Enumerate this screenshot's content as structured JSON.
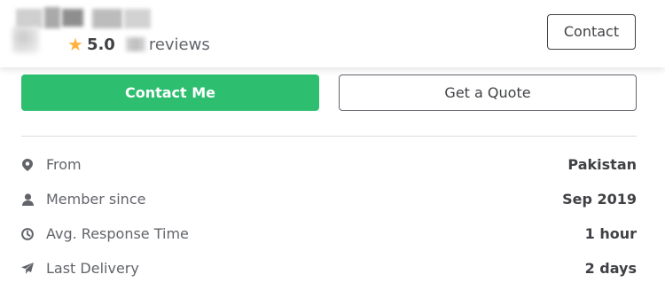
{
  "header": {
    "rating_score": "5.0",
    "reviews_label": "reviews",
    "contact_button": "Contact"
  },
  "actions": {
    "contact_me": "Contact Me",
    "get_quote": "Get a Quote"
  },
  "stats": [
    {
      "icon": "location-pin-icon",
      "label": "From",
      "value": "Pakistan"
    },
    {
      "icon": "user-icon",
      "label": "Member since",
      "value": "Sep 2019"
    },
    {
      "icon": "clock-icon",
      "label": "Avg. Response Time",
      "value": "1 hour"
    },
    {
      "icon": "paper-plane-icon",
      "label": "Last Delivery",
      "value": "2 days"
    }
  ],
  "colors": {
    "brand_green": "#2dbe6f",
    "star": "#ffb33e",
    "text_dark": "#404145",
    "text_muted": "#62646a"
  }
}
